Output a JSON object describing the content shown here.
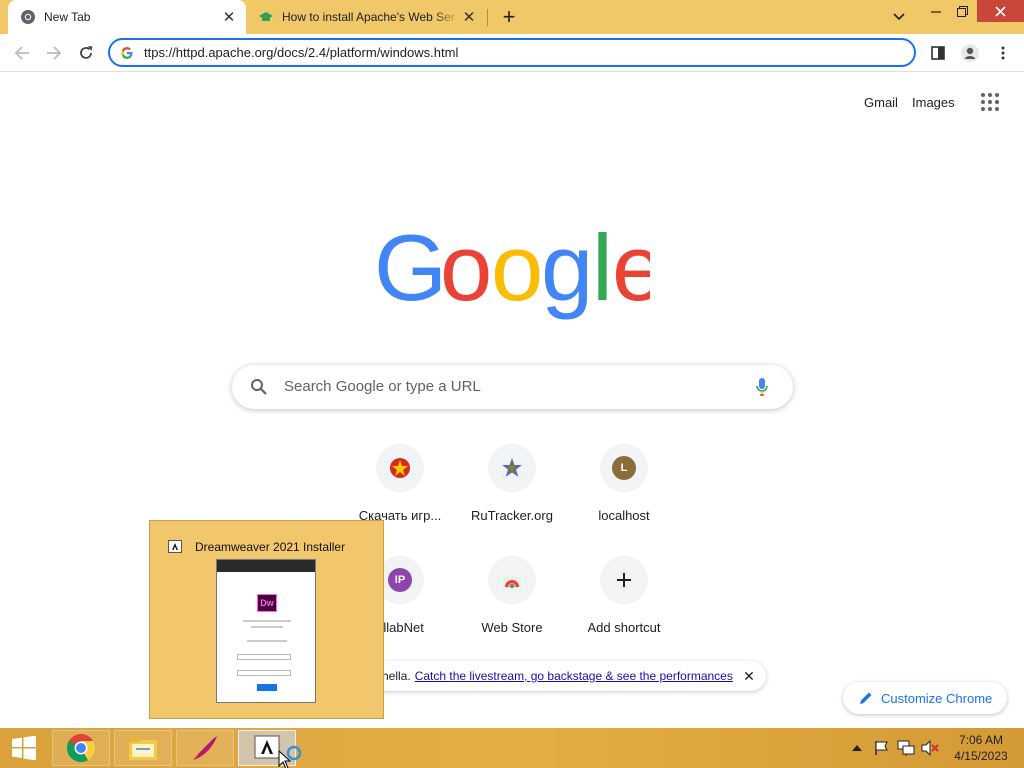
{
  "browser": {
    "tabs": [
      {
        "title": "New Tab",
        "active": true
      },
      {
        "title": "How to install Apache's Web Ser",
        "active": false
      }
    ],
    "url": "ttps://httpd.apache.org/docs/2.4/platform/windows.html"
  },
  "ntp": {
    "top_links": [
      "Gmail",
      "Images"
    ],
    "logo_letters": [
      "G",
      "o",
      "o",
      "g",
      "l",
      "e"
    ],
    "search_placeholder": "Search Google or type a URL",
    "shortcuts": [
      {
        "label": "Скачать игр...",
        "icon": "red-star-icon"
      },
      {
        "label": "RuTracker.org",
        "icon": "rutracker-icon"
      },
      {
        "label": "localhost",
        "icon": "letter-avatar",
        "letter": "L",
        "color": "#8a6d3b"
      },
      {
        "label": "ollabNet",
        "icon": "letter-avatar",
        "letter": "IP",
        "color": "#8e44ad"
      },
      {
        "label": "Web Store",
        "icon": "webstore-icon"
      },
      {
        "label": "Add shortcut",
        "icon": "plus-icon"
      }
    ],
    "promo": {
      "prefix": "hella.",
      "link": "Catch the livestream, go backstage & see the performances"
    },
    "customize_label": "Customize Chrome"
  },
  "taskbar_preview": {
    "title": "Dreamweaver 2021 Installer",
    "thumb_logo": "Dw"
  },
  "taskbar": {
    "apps": [
      "chrome",
      "file-explorer",
      "apache-feather",
      "adobe-installer"
    ],
    "clock_time": "7:06 AM",
    "clock_date": "4/15/2023"
  },
  "colors": {
    "tabstrip": "#f0c868",
    "accent": "#1a73e8",
    "google_blue": "#4285f4",
    "google_red": "#ea4335",
    "google_yellow": "#fbbc05",
    "google_green": "#34a853"
  }
}
